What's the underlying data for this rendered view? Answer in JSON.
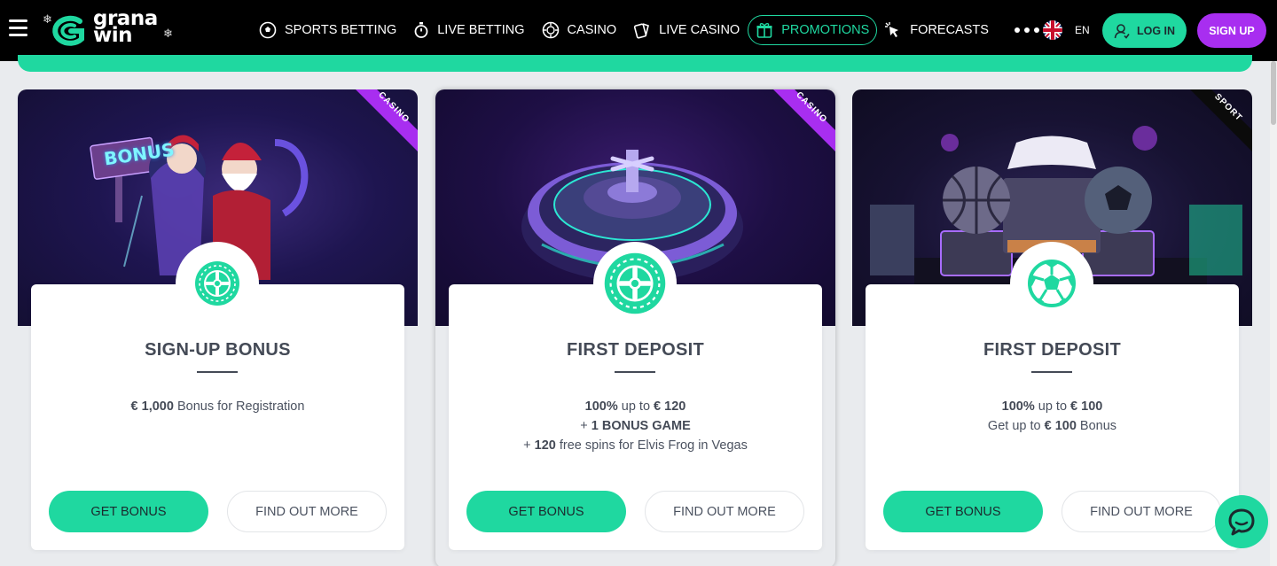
{
  "header": {
    "logo_top": "grana",
    "logo_bottom": "win",
    "nav": [
      {
        "label": "SPORTS BETTING",
        "icon": "football-icon"
      },
      {
        "label": "LIVE BETTING",
        "icon": "stopwatch-icon"
      },
      {
        "label": "CASINO",
        "icon": "casino-chip-icon"
      },
      {
        "label": "LIVE CASINO",
        "icon": "cards-icon"
      },
      {
        "label": "PROMOTIONS",
        "icon": "gift-icon"
      },
      {
        "label": "FORECASTS",
        "icon": "cursor-click-icon"
      }
    ],
    "language": "EN",
    "login_label": "LOG IN",
    "signup_label": "SIGN UP"
  },
  "colors": {
    "accent": "#1fd8a0",
    "signup": "#a82ef0",
    "text": "#444a56",
    "header_bg": "#000000"
  },
  "cards": [
    {
      "ribbon": "CASINO",
      "banner_sign": "BONUS",
      "badge_icon": "roulette-icon",
      "title": "SIGN-UP BONUS",
      "line1_bold": "€ 1,000",
      "line1_text": " Bonus for Registration",
      "get_label": "GET BONUS",
      "more_label": "FIND OUT MORE"
    },
    {
      "ribbon": "CASINO",
      "badge_icon": "roulette-icon",
      "title": "FIRST DEPOSIT",
      "line1_bold": "100%",
      "line1_text": " up to ",
      "line1_bold2": "€ 120",
      "line2_prefix": "+ ",
      "line2_bold": "1 BONUS GAME",
      "line3_prefix": "+ ",
      "line3_bold": "120",
      "line3_text": " free spins for Elvis Frog in Vegas",
      "get_label": "GET BONUS",
      "more_label": "FIND OUT MORE"
    },
    {
      "ribbon": "SPORT",
      "badge_icon": "soccer-ball-icon",
      "title": "FIRST DEPOSIT",
      "line1_bold": "100%",
      "line1_text": " up to ",
      "line1_bold2": "€ 100",
      "line2_text": "Get up to ",
      "line2_bold": "€ 100",
      "line2_suffix": " Bonus",
      "get_label": "GET BONUS",
      "more_label": "FIND OUT MORE"
    }
  ]
}
